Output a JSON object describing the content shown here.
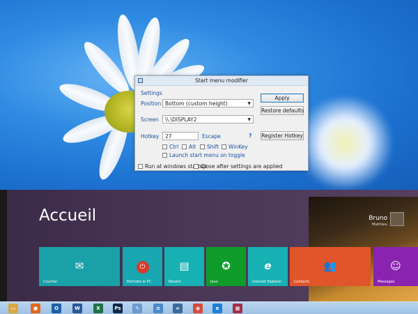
{
  "dialog": {
    "title": "Start menu modifier",
    "settings_label": "Settings",
    "position_label": "Position",
    "position_value": "Bottom (custom height)",
    "screen_label": "Screen",
    "screen_value": "\\\\.\\DISPLAY2",
    "hotkey_label": "Hotkey",
    "hotkey_value": "27",
    "hotkey_key": "Escape",
    "help_mark": "?",
    "ctrl_label": "Ctrl",
    "alt_label": "Alt",
    "shift_label": "Shift",
    "winkey_label": "WinKey",
    "toggle_label": "Launch start menu on toggle",
    "startup_label": "Run at windows startup",
    "close_after_label": "Close after settings are applied",
    "apply_button": "Apply",
    "restore_button": "Restore defaults",
    "register_button": "Register Hotkey"
  },
  "start_screen": {
    "title": "Accueil",
    "user_name": "Bruno",
    "user_sub": "Mathieu",
    "tiles": [
      {
        "label": "Courrier",
        "icon": "mail-icon",
        "color": "#1aa0a8"
      },
      {
        "label": "Eteindre le PC",
        "icon": "power-icon",
        "color": "#18a7b0"
      },
      {
        "label": "Recent",
        "icon": "recent-icon",
        "color": "#17b1b4"
      },
      {
        "label": "Jeux",
        "icon": "gamepad-icon",
        "color": "#0f9c2a"
      },
      {
        "label": "Internet Explorer",
        "icon": "ie-icon",
        "color": "#17b1b4"
      },
      {
        "label": "Contacts",
        "icon": "people-icon",
        "color": "#e0552a"
      },
      {
        "label": "Messages",
        "icon": "message-icon",
        "color": "#8a24b0"
      }
    ]
  },
  "taskbar": {
    "icons": [
      {
        "name": "explorer-icon",
        "glyph": "▭",
        "color": "#d8a840"
      },
      {
        "name": "firefox-icon",
        "glyph": "●",
        "color": "#e06a1a"
      },
      {
        "name": "outlook-icon",
        "glyph": "O",
        "color": "#1f5fa8"
      },
      {
        "name": "word-icon",
        "glyph": "W",
        "color": "#2b5797"
      },
      {
        "name": "excel-icon",
        "glyph": "X",
        "color": "#207245"
      },
      {
        "name": "photoshop-icon",
        "glyph": "Ps",
        "color": "#0e2a47"
      },
      {
        "name": "paint-icon",
        "glyph": "✎",
        "color": "#6a9ad0"
      },
      {
        "name": "notepad-icon",
        "glyph": "≡",
        "color": "#4a8ac8"
      },
      {
        "name": "link-icon",
        "glyph": "∞",
        "color": "#3a6a9a"
      },
      {
        "name": "chrome-icon",
        "glyph": "◉",
        "color": "#d94a38"
      },
      {
        "name": "ie-taskbar-icon",
        "glyph": "e",
        "color": "#1e7fd6"
      },
      {
        "name": "app-grid-icon",
        "glyph": "▦",
        "color": "#a0304a"
      }
    ]
  }
}
